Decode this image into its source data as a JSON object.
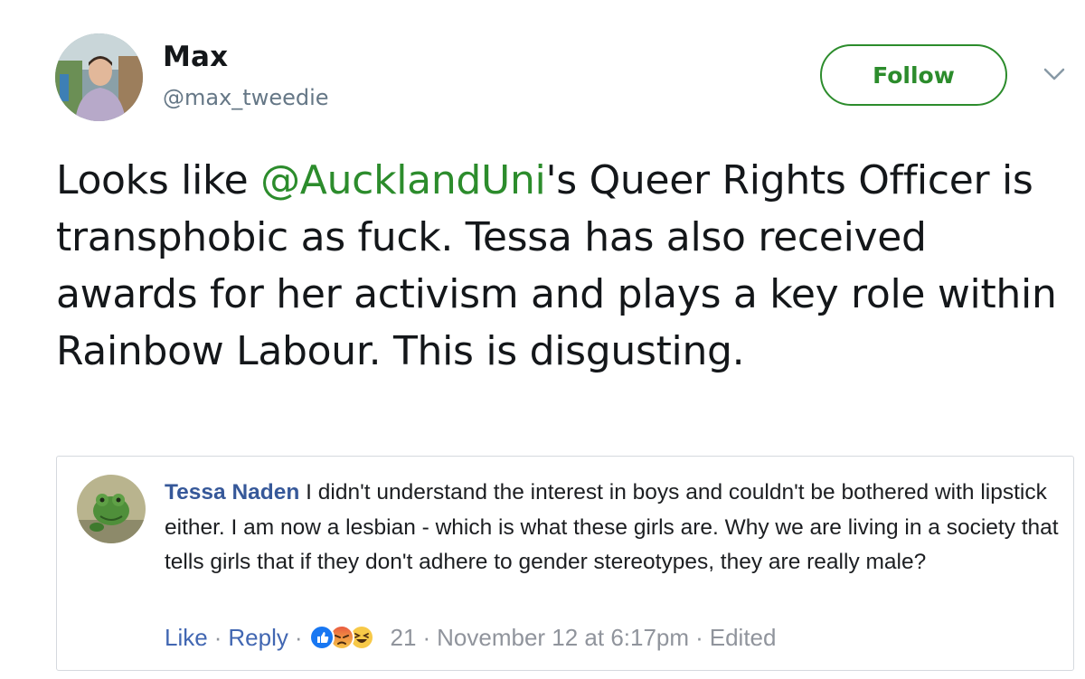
{
  "tweet": {
    "display_name": "Max",
    "handle": "@max_tweedie",
    "follow_label": "Follow",
    "text_before": "Looks like ",
    "mention": "@AucklandUni",
    "text_after": "'s Queer Rights Officer is transphobic as fuck. Tessa has also received awards for her activism and plays a key role within Rainbow Labour. This is disgusting."
  },
  "embedded_comment": {
    "author": "Tessa Naden",
    "text": " I didn't understand the interest in boys and couldn't be bothered with lipstick either. I am now a lesbian - which is what these girls are. Why we are living in a society that tells girls that if they don't adhere to gender stereotypes, they are really male?",
    "like_label": "Like",
    "reply_label": "Reply",
    "separator": "·",
    "reaction_count": "21",
    "timestamp": "November 12 at 6:17pm",
    "edited_label": "Edited",
    "reactions": [
      "like-reaction-icon",
      "angry-reaction-icon",
      "haha-reaction-icon"
    ]
  },
  "colors": {
    "accent_green": "#2c8c2c",
    "fb_link_blue": "#4267b2",
    "fb_author_blue": "#365899",
    "muted_gray": "#657786"
  }
}
